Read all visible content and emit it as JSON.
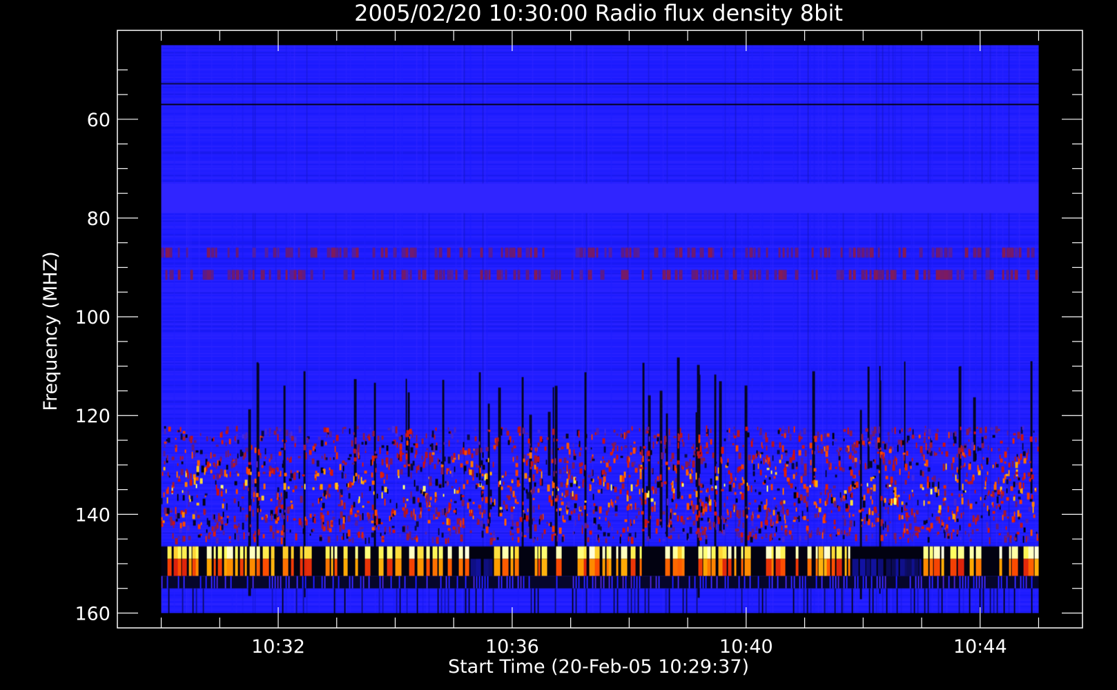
{
  "chart_data": {
    "type": "heatmap",
    "title": "2005/02/20 10:30:00 Radio flux density 8bit",
    "xlabel": "Start Time (20-Feb-05 10:29:37)",
    "ylabel": "Frequency (MHZ)",
    "x_tick_labels": [
      "10:32",
      "10:36",
      "10:40",
      "10:44"
    ],
    "x_ticks_minutes": [
      32,
      36,
      40,
      44
    ],
    "x_data_range_minutes": [
      30.0,
      45.0
    ],
    "xlim_minutes": [
      29.25,
      45.75
    ],
    "y_tick_labels": [
      "60",
      "80",
      "100",
      "120",
      "140",
      "160"
    ],
    "y_ticks": [
      60,
      80,
      100,
      120,
      140,
      160
    ],
    "y_data_range": [
      45,
      160
    ],
    "ylim": [
      42,
      163
    ],
    "y_inverted": true,
    "colormap": [
      "#000000",
      "#0b0b55",
      "#1a1aff",
      "#3a2aff",
      "#5a1a8c",
      "#9a1a3a",
      "#d01010",
      "#ff5000",
      "#ffa500",
      "#ffff60",
      "#ffffe0"
    ],
    "features": [
      {
        "type": "background",
        "freq_range": [
          45,
          160
        ],
        "level": 0.22
      },
      {
        "type": "dark_line",
        "freq": 57,
        "level": 0.02
      },
      {
        "type": "dark_line",
        "freq": 52.8,
        "level": 0.08
      },
      {
        "type": "band",
        "freq_range": [
          73,
          79
        ],
        "level": 0.27
      },
      {
        "type": "pulsed_band",
        "freq_range": [
          86,
          88
        ],
        "level": 0.42
      },
      {
        "type": "pulsed_band",
        "freq_range": [
          90.5,
          92.5
        ],
        "level": 0.42
      },
      {
        "type": "burst_region",
        "freq_range": [
          122,
          145
        ],
        "peak_freq": 134,
        "max_level": 0.92
      },
      {
        "type": "bright_band",
        "freq_range": [
          146.5,
          152.5
        ],
        "level": 0.97,
        "gap_minutes": [
          [
            35.2,
            35.6
          ],
          [
            41.8,
            43.0
          ]
        ]
      },
      {
        "type": "dark_band",
        "freq_range": [
          152.5,
          155
        ],
        "level": 0.05
      }
    ]
  }
}
